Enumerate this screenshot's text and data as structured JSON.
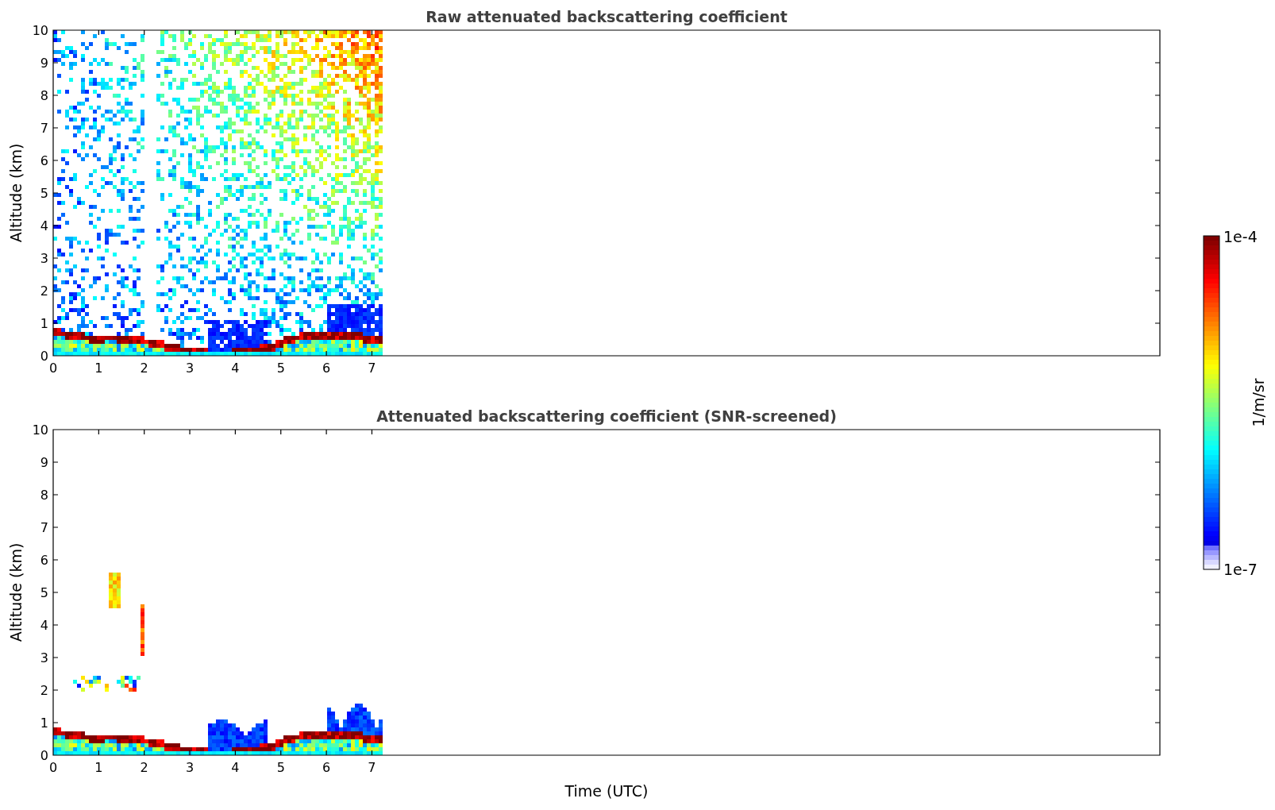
{
  "panels": [
    {
      "kind": "raw",
      "title": "Raw attenuated backscattering coefficient",
      "ylabel": "Altitude (km)",
      "yticks": [
        "10",
        "9",
        "8",
        "7",
        "6",
        "5",
        "4",
        "3",
        "2",
        "1",
        "0"
      ],
      "xticks": [
        "0",
        "1",
        "2",
        "3",
        "4",
        "5",
        "6",
        "7"
      ]
    },
    {
      "kind": "screened",
      "title": "Attenuated backscattering coefficient (SNR-screened)",
      "ylabel": "Altitude (km)",
      "yticks": [
        "10",
        "9",
        "8",
        "7",
        "6",
        "5",
        "4",
        "3",
        "2",
        "1",
        "0"
      ],
      "xticks": [
        "0",
        "1",
        "2",
        "3",
        "4",
        "5",
        "6",
        "7"
      ]
    }
  ],
  "xlabel": "Time (UTC)",
  "colorbar": {
    "max_label": "1e-4",
    "min_label": "1e-7",
    "unit": "1/m/sr"
  }
}
